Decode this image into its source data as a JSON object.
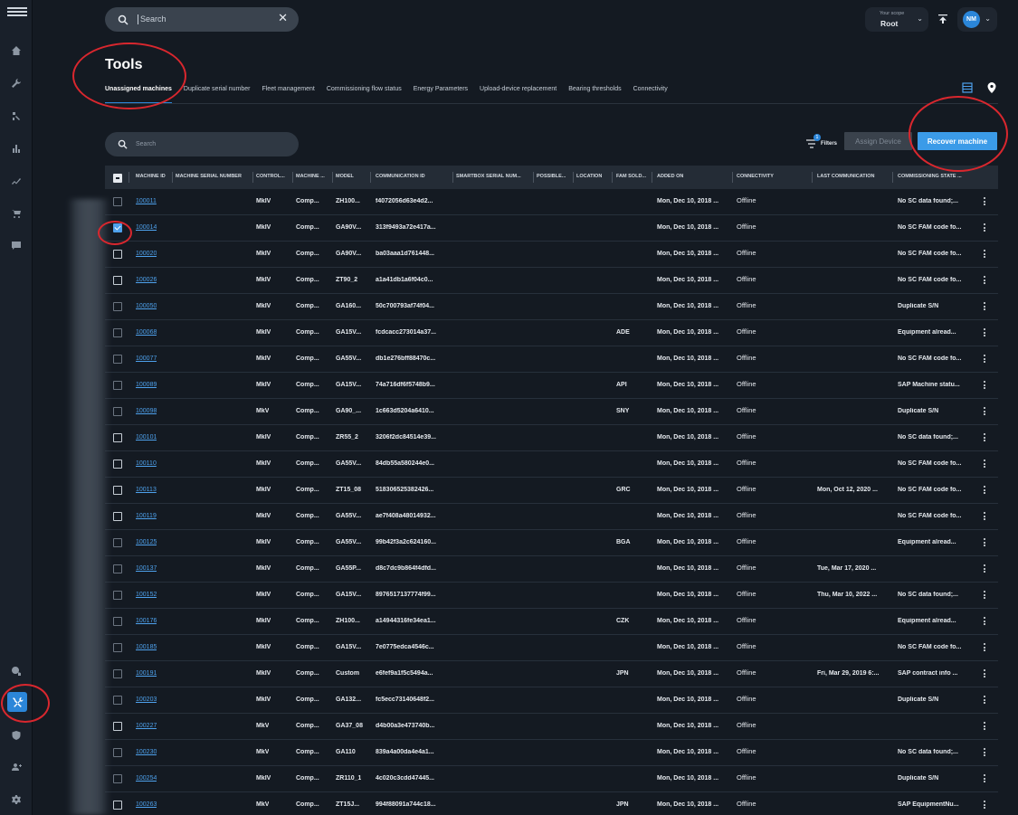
{
  "app": {
    "search_placeholder": "Search",
    "scope": {
      "label": "Your scope",
      "value": "Root"
    },
    "user_initials": "NM"
  },
  "page": {
    "title": "Tools",
    "tabs": [
      {
        "label": "Unassigned machines",
        "active": true
      },
      {
        "label": "Duplicate serial number"
      },
      {
        "label": "Fleet management"
      },
      {
        "label": "Commissioning flow status"
      },
      {
        "label": "Energy Parameters"
      },
      {
        "label": "Upload-device replacement"
      },
      {
        "label": "Bearing thresholds"
      },
      {
        "label": "Connectivity"
      }
    ]
  },
  "table_tools": {
    "search_placeholder": "Search",
    "filters_label": "Filters",
    "filters_count": "1",
    "assign_label": "Assign Device",
    "recover_label": "Recover machine"
  },
  "columns": [
    "MACHINE ID",
    "MACHINE SERIAL NUMBER",
    "CONTROL...",
    "MACHINE ...",
    "MODEL",
    "COMMUNICATION ID",
    "SMARTBOX SERIAL NUM...",
    "POSSIBLE...",
    "LOCATION",
    "FAM SOLD...",
    "ADDED ON",
    "CONNECTIVITY",
    "LAST COMMUNICATION",
    "COMMISSIONING STATE ..."
  ],
  "rows": [
    {
      "id": "100011",
      "control": "MkIV",
      "machine": "Comp...",
      "model": "ZH100...",
      "comm": "f4072056d63e4d2...",
      "fam": "",
      "added": "Mon, Dec 10, 2018 ...",
      "conn": "Offline",
      "last": "",
      "state": "No SC data found;...",
      "checked": false,
      "dim": true
    },
    {
      "id": "100014",
      "control": "MkIV",
      "machine": "Comp...",
      "model": "GA90V...",
      "comm": "313f9493a72e417a...",
      "fam": "",
      "added": "Mon, Dec 10, 2018 ...",
      "conn": "Offline",
      "last": "",
      "state": "No SC FAM code fo...",
      "checked": true,
      "dim": false
    },
    {
      "id": "100020",
      "control": "MkIV",
      "machine": "Comp...",
      "model": "GA90V...",
      "comm": "ba03aaa1d761448...",
      "fam": "",
      "added": "Mon, Dec 10, 2018 ...",
      "conn": "Offline",
      "last": "",
      "state": "No SC FAM code fo...",
      "checked": false,
      "dim": false
    },
    {
      "id": "100026",
      "control": "MkIV",
      "machine": "Comp...",
      "model": "ZT90_2",
      "comm": "a1a41db1a6f04c0...",
      "fam": "",
      "added": "Mon, Dec 10, 2018 ...",
      "conn": "Offline",
      "last": "",
      "state": "No SC FAM code fo...",
      "checked": false,
      "dim": false
    },
    {
      "id": "100050",
      "control": "MkIV",
      "machine": "Comp...",
      "model": "GA160...",
      "comm": "50c700793af74f04...",
      "fam": "",
      "added": "Mon, Dec 10, 2018 ...",
      "conn": "Offline",
      "last": "",
      "state": "Duplicate S/N",
      "checked": false,
      "dim": true
    },
    {
      "id": "100068",
      "control": "MkIV",
      "machine": "Comp...",
      "model": "GA15V...",
      "comm": "fcdcacc273014a37...",
      "fam": "ADE",
      "added": "Mon, Dec 10, 2018 ...",
      "conn": "Offline",
      "last": "",
      "state": "Equipment alread...",
      "checked": false,
      "dim": true
    },
    {
      "id": "100077",
      "control": "MkIV",
      "machine": "Comp...",
      "model": "GA55V...",
      "comm": "db1e276bff88470c...",
      "fam": "",
      "added": "Mon, Dec 10, 2018 ...",
      "conn": "Offline",
      "last": "",
      "state": "No SC FAM code fo...",
      "checked": false,
      "dim": true
    },
    {
      "id": "100089",
      "control": "MkIV",
      "machine": "Comp...",
      "model": "GA15V...",
      "comm": "74a716df6f5748b9...",
      "fam": "API",
      "added": "Mon, Dec 10, 2018 ...",
      "conn": "Offline",
      "last": "",
      "state": "SAP Machine statu...",
      "checked": false,
      "dim": true
    },
    {
      "id": "100098",
      "control": "MkV",
      "machine": "Comp...",
      "model": "GA90_...",
      "comm": "1c663d5204a6410...",
      "fam": "SNY",
      "added": "Mon, Dec 10, 2018 ...",
      "conn": "Offline",
      "last": "",
      "state": "Duplicate S/N",
      "checked": false,
      "dim": true
    },
    {
      "id": "100101",
      "control": "MkIV",
      "machine": "Comp...",
      "model": "ZR55_2",
      "comm": "3206f2dc84514e39...",
      "fam": "",
      "added": "Mon, Dec 10, 2018 ...",
      "conn": "Offline",
      "last": "",
      "state": "No SC data found;...",
      "checked": false,
      "dim": false
    },
    {
      "id": "100110",
      "control": "MkIV",
      "machine": "Comp...",
      "model": "GA55V...",
      "comm": "84db55a580244e0...",
      "fam": "",
      "added": "Mon, Dec 10, 2018 ...",
      "conn": "Offline",
      "last": "",
      "state": "No SC FAM code fo...",
      "checked": false,
      "dim": false
    },
    {
      "id": "100113",
      "control": "MkIV",
      "machine": "Comp...",
      "model": "ZT15_08",
      "comm": "518306525382426...",
      "fam": "GRC",
      "added": "Mon, Dec 10, 2018 ...",
      "conn": "Offline",
      "last": "Mon, Oct 12, 2020 ...",
      "state": "No SC FAM code fo...",
      "checked": false,
      "dim": false
    },
    {
      "id": "100119",
      "control": "MkIV",
      "machine": "Comp...",
      "model": "GA55V...",
      "comm": "ae7f408a48014932...",
      "fam": "",
      "added": "Mon, Dec 10, 2018 ...",
      "conn": "Offline",
      "last": "",
      "state": "No SC FAM code fo...",
      "checked": false,
      "dim": false
    },
    {
      "id": "100125",
      "control": "MkIV",
      "machine": "Comp...",
      "model": "GA55V...",
      "comm": "99b42f3a2c624160...",
      "fam": "BGA",
      "added": "Mon, Dec 10, 2018 ...",
      "conn": "Offline",
      "last": "",
      "state": "Equipment alread...",
      "checked": false,
      "dim": true
    },
    {
      "id": "100137",
      "control": "MkIV",
      "machine": "Comp...",
      "model": "GA55P...",
      "comm": "d8c7dc9b864f4dfd...",
      "fam": "",
      "added": "Mon, Dec 10, 2018 ...",
      "conn": "Offline",
      "last": "Tue, Mar 17, 2020 ...",
      "state": "",
      "checked": false,
      "dim": true
    },
    {
      "id": "100152",
      "control": "MkIV",
      "machine": "Comp...",
      "model": "GA15V...",
      "comm": "8976517137774f99...",
      "fam": "",
      "added": "Mon, Dec 10, 2018 ...",
      "conn": "Offline",
      "last": "Thu, Mar 10, 2022 ...",
      "state": "No SC data found;...",
      "checked": false,
      "dim": true
    },
    {
      "id": "100176",
      "control": "MkIV",
      "machine": "Comp...",
      "model": "ZH100...",
      "comm": "a14944316fe34ea1...",
      "fam": "CZK",
      "added": "Mon, Dec 10, 2018 ...",
      "conn": "Offline",
      "last": "",
      "state": "Equipment alread...",
      "checked": false,
      "dim": true
    },
    {
      "id": "100185",
      "control": "MkIV",
      "machine": "Comp...",
      "model": "GA15V...",
      "comm": "7e0775edca4546c...",
      "fam": "",
      "added": "Mon, Dec 10, 2018 ...",
      "conn": "Offline",
      "last": "",
      "state": "No SC FAM code fo...",
      "checked": false,
      "dim": true
    },
    {
      "id": "100191",
      "control": "MkIV",
      "machine": "Comp...",
      "model": "Custom",
      "comm": "e6fef9a1f5c5494a...",
      "fam": "JPN",
      "added": "Mon, Dec 10, 2018 ...",
      "conn": "Offline",
      "last": "Fri, Mar 29, 2019 6:...",
      "state": "SAP contract info ...",
      "checked": false,
      "dim": true
    },
    {
      "id": "100203",
      "control": "MkIV",
      "machine": "Comp...",
      "model": "GA132...",
      "comm": "fc5ecc73140648f2...",
      "fam": "",
      "added": "Mon, Dec 10, 2018 ...",
      "conn": "Offline",
      "last": "",
      "state": "Duplicate S/N",
      "checked": false,
      "dim": true
    },
    {
      "id": "100227",
      "control": "MkV",
      "machine": "Comp...",
      "model": "GA37_08",
      "comm": "d4b00a3e473740b...",
      "fam": "",
      "added": "Mon, Dec 10, 2018 ...",
      "conn": "Offline",
      "last": "",
      "state": "",
      "checked": false,
      "dim": false
    },
    {
      "id": "100230",
      "control": "MkV",
      "machine": "Comp...",
      "model": "GA110",
      "comm": "839a4a00da4e4a1...",
      "fam": "",
      "added": "Mon, Dec 10, 2018 ...",
      "conn": "Offline",
      "last": "",
      "state": "No SC data found;...",
      "checked": false,
      "dim": true
    },
    {
      "id": "100254",
      "control": "MkIV",
      "machine": "Comp...",
      "model": "ZR110_1",
      "comm": "4c020c3cdd47445...",
      "fam": "",
      "added": "Mon, Dec 10, 2018 ...",
      "conn": "Offline",
      "last": "",
      "state": "Duplicate S/N",
      "checked": false,
      "dim": true
    },
    {
      "id": "100263",
      "control": "MkV",
      "machine": "Comp...",
      "model": "ZT15J...",
      "comm": "994f88091a744c18...",
      "fam": "JPN",
      "added": "Mon, Dec 10, 2018 ...",
      "conn": "Offline",
      "last": "",
      "state": "SAP EquipmentNu...",
      "checked": false,
      "dim": false
    }
  ],
  "colors": {
    "accent": "#2b86d9",
    "background": "#141a22",
    "annotation": "#d9272e"
  }
}
